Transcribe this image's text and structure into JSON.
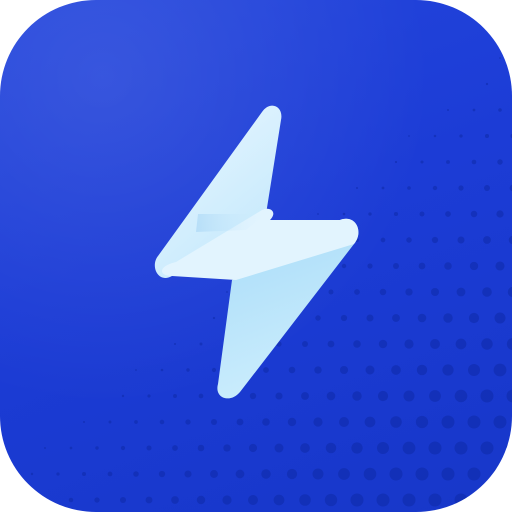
{
  "app_icon": {
    "icon": "lightning-bolt-icon",
    "colors": {
      "tile_top": "#2446dc",
      "tile_bottom": "#1737c9",
      "bolt_light": "#dff2fd",
      "bolt_mid": "#b9e4fb",
      "bolt_shadow": "#8fcff6",
      "dot_color": "#0f2aa8"
    }
  }
}
